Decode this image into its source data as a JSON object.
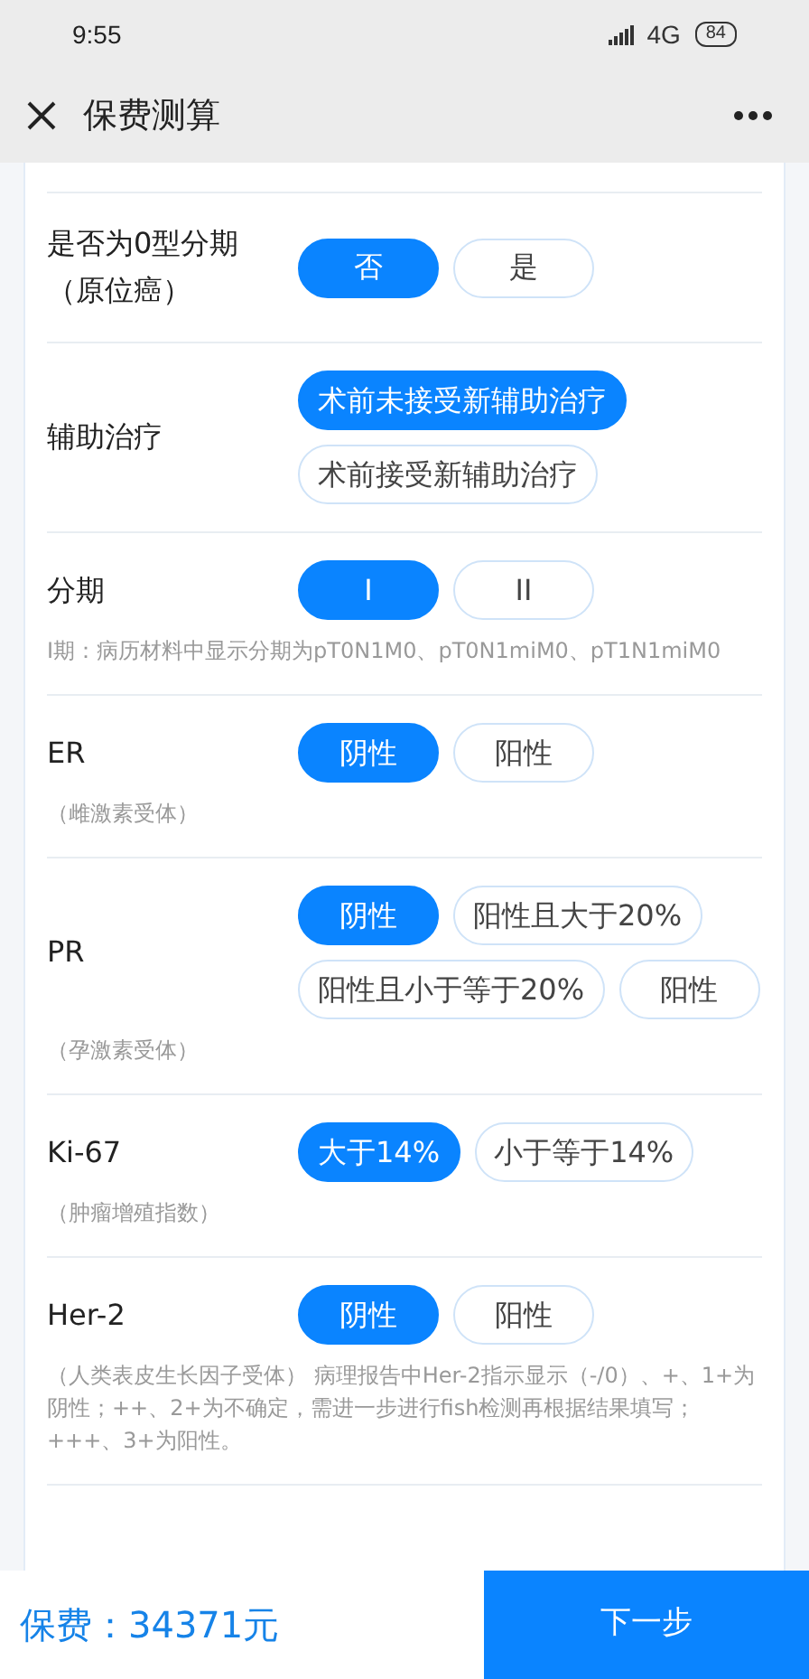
{
  "status_bar": {
    "time": "9:55",
    "network": "4G",
    "battery": "84"
  },
  "nav": {
    "title": "保费测算"
  },
  "questions": [
    {
      "label": "是否为0型分期（原位癌）",
      "options": [
        {
          "label": "否",
          "selected": true
        },
        {
          "label": "是",
          "selected": false
        }
      ]
    },
    {
      "label": "辅助治疗",
      "options": [
        {
          "label": "术前未接受新辅助治疗",
          "selected": true
        },
        {
          "label": "术前接受新辅助治疗",
          "selected": false
        }
      ]
    },
    {
      "label": "分期",
      "options": [
        {
          "label": "I",
          "selected": true
        },
        {
          "label": "II",
          "selected": false
        }
      ],
      "note": "I期：病历材料中显示分期为pT0N1M0、pT0N1miM0、pT1N1miM0"
    },
    {
      "label": "ER",
      "options": [
        {
          "label": "阴性",
          "selected": true
        },
        {
          "label": "阳性",
          "selected": false
        }
      ],
      "note": "（雌激素受体）"
    },
    {
      "label": "PR",
      "options": [
        {
          "label": "阴性",
          "selected": true
        },
        {
          "label": "阳性且大于20%",
          "selected": false
        },
        {
          "label": "阳性且小于等于20%",
          "selected": false
        },
        {
          "label": "阳性",
          "selected": false
        }
      ],
      "note": "（孕激素受体）"
    },
    {
      "label": "Ki-67",
      "options": [
        {
          "label": "大于14%",
          "selected": true
        },
        {
          "label": "小于等于14%",
          "selected": false
        }
      ],
      "note": "（肿瘤增殖指数）"
    },
    {
      "label": "Her-2",
      "options": [
        {
          "label": "阴性",
          "selected": true
        },
        {
          "label": "阳性",
          "selected": false
        }
      ],
      "note": "（人类表皮生长因子受体） 病理报告中Her-2指示显示（-/0）、+、1+为阴性；++、2+为不确定，需进一步进行fish检测再根据结果填写；+++、3+为阳性。"
    }
  ],
  "footer": {
    "premium": "保费：34371元",
    "next_button": "下一步"
  }
}
